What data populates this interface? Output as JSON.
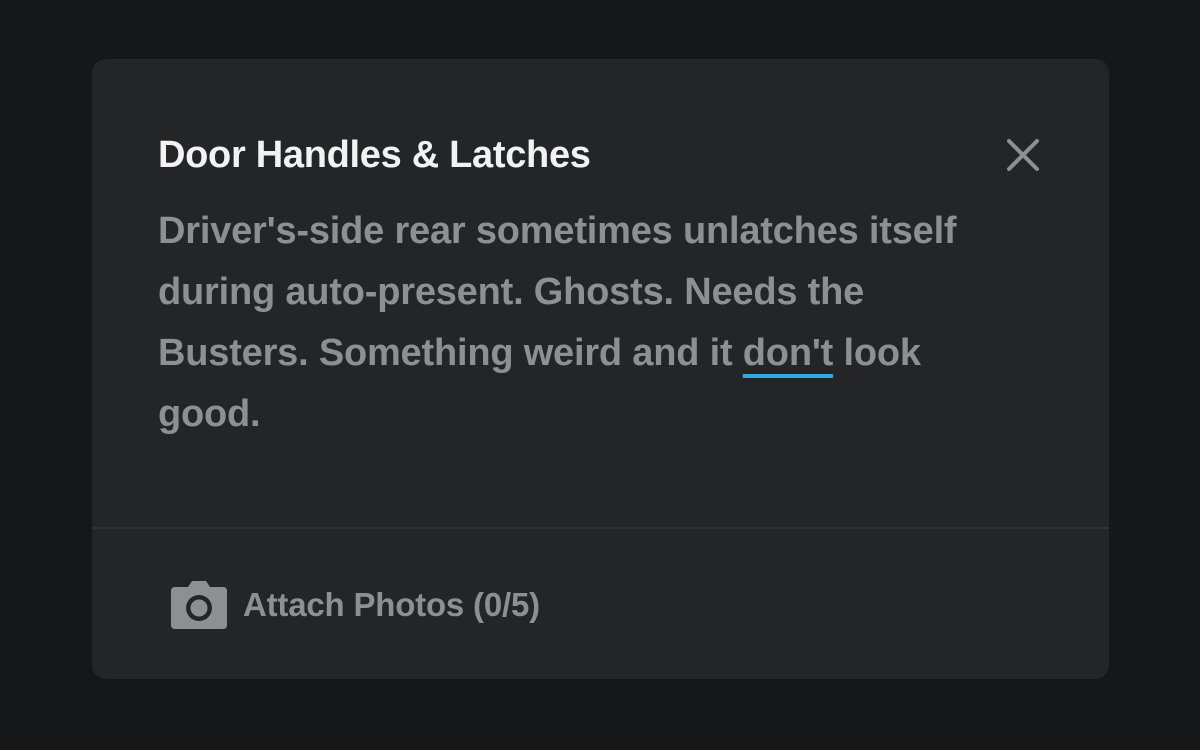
{
  "note": {
    "title": "Door Handles & Latches",
    "body_before": "Driver's-side rear sometimes unlatches itself during auto-present. Ghosts. Needs the Busters. Something weird and it ",
    "misspelled_word": "don't",
    "body_after": " look good.",
    "spellcheck_underline_color": "#2ea8e0"
  },
  "close_icon": "close-icon",
  "attach": {
    "icon": "camera-icon",
    "label": "Attach Photos (0/5)"
  }
}
